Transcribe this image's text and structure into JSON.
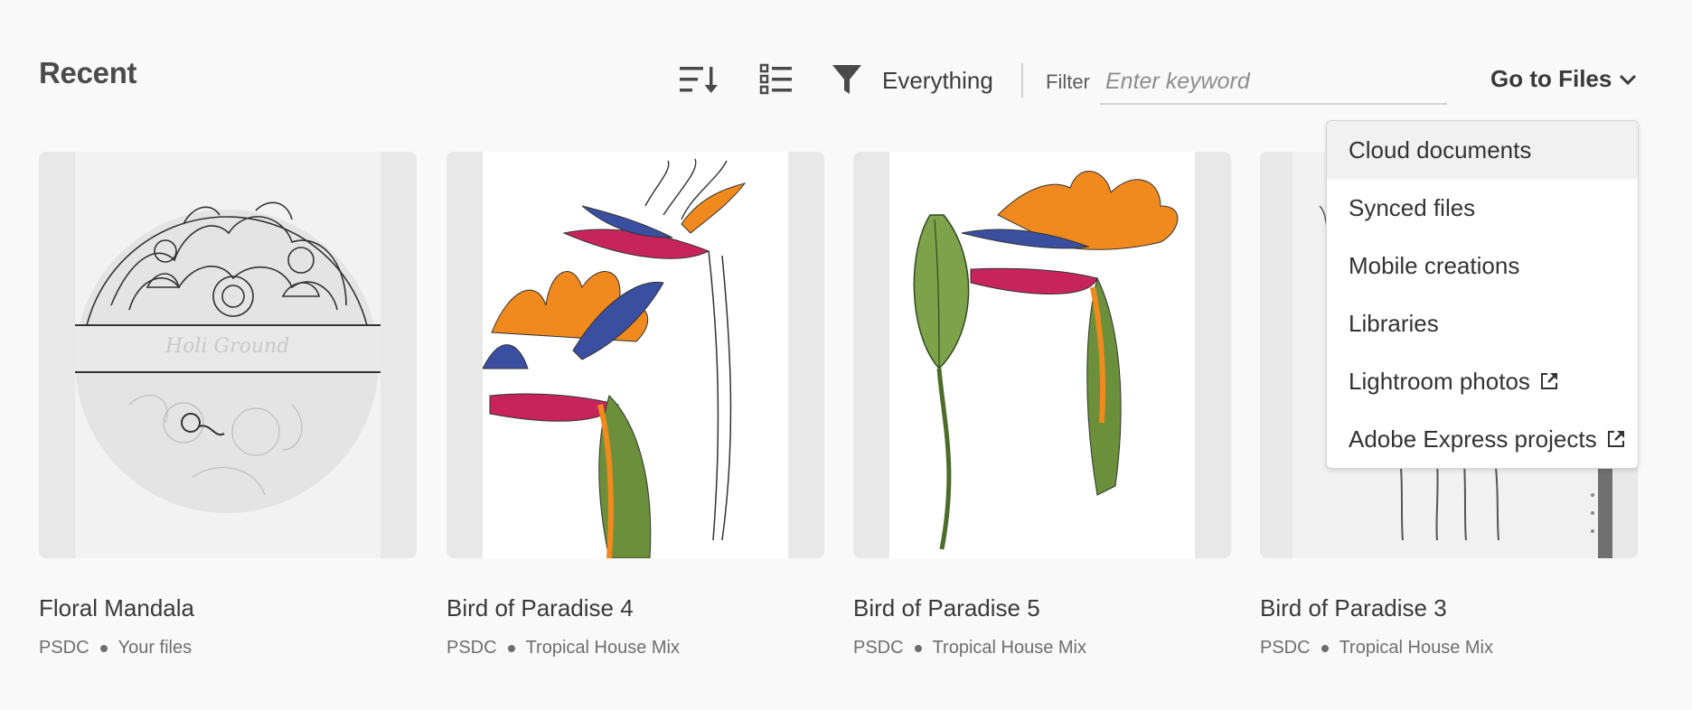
{
  "header": {
    "title": "Recent",
    "filter_scope": "Everything",
    "filter_label": "Filter",
    "filter_placeholder": "Enter keyword",
    "filter_value": "",
    "goto_label": "Go to Files"
  },
  "icons": [
    "sort-icon",
    "list-view-icon",
    "filter-funnel-icon",
    "chevron-down-icon",
    "external-link-icon"
  ],
  "cards": [
    {
      "title": "Floral Mandala",
      "type": "PSDC",
      "location": "Your files",
      "thumbnail": "floral mandala sketch"
    },
    {
      "title": "Bird of Paradise 4",
      "type": "PSDC",
      "location": "Tropical House Mix",
      "thumbnail": "bird of paradise flower illustration"
    },
    {
      "title": "Bird of Paradise 5",
      "type": "PSDC",
      "location": "Tropical House Mix",
      "thumbnail": "bird of paradise flower with leaf illustration"
    },
    {
      "title": "Bird of Paradise 3",
      "type": "PSDC",
      "location": "Tropical House Mix",
      "thumbnail": "pencil sketch of stems"
    }
  ],
  "goto_menu": {
    "items": [
      {
        "label": "Cloud documents",
        "external": false,
        "highlighted": true
      },
      {
        "label": "Synced files",
        "external": false
      },
      {
        "label": "Mobile creations",
        "external": false
      },
      {
        "label": "Libraries",
        "external": false
      },
      {
        "label": "Lightroom photos",
        "external": true
      },
      {
        "label": "Adobe Express projects",
        "external": true
      }
    ]
  },
  "colors": {
    "background": "#f9f9f9",
    "thumb_bg": "#e8e8e8",
    "petal_orange": "#f08a1e",
    "bract_magenta": "#c8245c",
    "petal_blue": "#3b4fa0",
    "leaf_green": "#6b8f3a"
  }
}
